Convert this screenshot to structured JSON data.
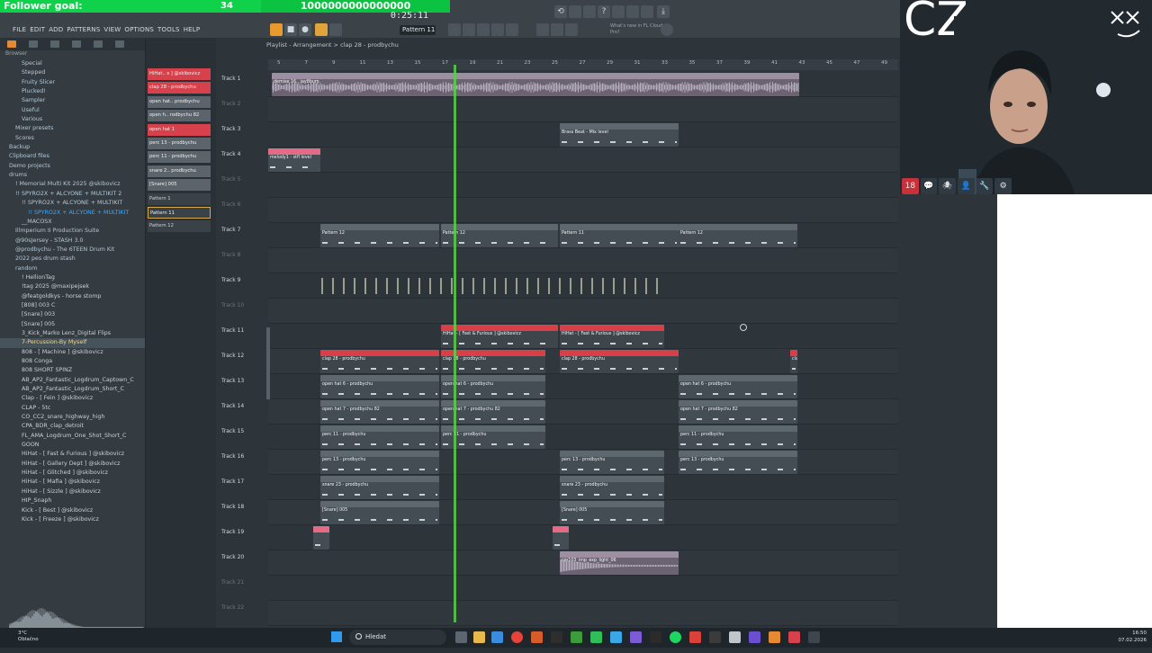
{
  "stream": {
    "follower_goal_label": "Follower goal:",
    "follower_count": "34",
    "follower_target": "1000000000000000",
    "channel_tag": "CZ"
  },
  "fl": {
    "menu": [
      "FILE",
      "EDIT",
      "ADD",
      "PATTERNS",
      "VIEW",
      "OPTIONS",
      "TOOLS",
      "HELP"
    ],
    "time_display": "0:25:11",
    "pattern_selector": "Pattern 11",
    "hint": "What's new in FL Cloud Pro?",
    "playlist_title": "Playlist - Arrangement > clap 28 - prodbychu",
    "ruler_ticks": [
      "5",
      "7",
      "9",
      "11",
      "13",
      "15",
      "17",
      "19",
      "21",
      "23",
      "25",
      "27",
      "29",
      "31",
      "33",
      "35",
      "37",
      "39",
      "41",
      "43",
      "45",
      "47",
      "49"
    ]
  },
  "browser": {
    "title": "Browser",
    "items": [
      {
        "label": "Special",
        "indent": 2,
        "kind": "folder"
      },
      {
        "label": "Stepped",
        "indent": 2,
        "kind": "folder"
      },
      {
        "label": "Fruity Slicer",
        "indent": 2,
        "kind": "folder"
      },
      {
        "label": "Plucked!",
        "indent": 2,
        "kind": "folder"
      },
      {
        "label": "Sampler",
        "indent": 2,
        "kind": "folder"
      },
      {
        "label": "Useful",
        "indent": 2,
        "kind": "folder"
      },
      {
        "label": "Various",
        "indent": 2,
        "kind": "folder"
      },
      {
        "label": "Mixer presets",
        "indent": 1,
        "kind": "folder"
      },
      {
        "label": "Scores",
        "indent": 1,
        "kind": "folder"
      },
      {
        "label": "Backup",
        "indent": 0,
        "kind": "folder"
      },
      {
        "label": "Clipboard files",
        "indent": 0,
        "kind": "folder"
      },
      {
        "label": "Demo projects",
        "indent": 0,
        "kind": "folder"
      },
      {
        "label": "drums",
        "indent": 0,
        "kind": "folder"
      },
      {
        "label": "! Memorial Multi Kit 2025 @skibovicz",
        "indent": 1,
        "kind": "folder"
      },
      {
        "label": "!! SPYRO2X + ALCYONE + MULTIKIT 2",
        "indent": 1,
        "kind": "folder"
      },
      {
        "label": "!! SPYRO2X + ALCYONE + MULTIKIT",
        "indent": 2,
        "kind": "folder"
      },
      {
        "label": "!! SPYRO2X + ALCYONE + MULTIKIT",
        "indent": 3,
        "kind": "hl"
      },
      {
        "label": "__MACOSX",
        "indent": 2,
        "kind": "folder"
      },
      {
        "label": "Illmperium II Production Suite",
        "indent": 1,
        "kind": "folder"
      },
      {
        "label": "@90sJersey - STASH 3.0",
        "indent": 1,
        "kind": "folder"
      },
      {
        "label": "@prodbychu - The 6TEEN Drum Kit",
        "indent": 1,
        "kind": "folder"
      },
      {
        "label": "2022 pes drum stash",
        "indent": 1,
        "kind": "folder"
      },
      {
        "label": "random",
        "indent": 1,
        "kind": "folder"
      },
      {
        "label": "! HellionTag",
        "indent": 2,
        "kind": "file"
      },
      {
        "label": "!tag 2025 @maxipejsek",
        "indent": 2,
        "kind": "file"
      },
      {
        "label": "@featgoldkys - horse stomp",
        "indent": 2,
        "kind": "file"
      },
      {
        "label": "[808] 003 C",
        "indent": 2,
        "kind": "file"
      },
      {
        "label": "[Snare] 003",
        "indent": 2,
        "kind": "file"
      },
      {
        "label": "[Snare] 005",
        "indent": 2,
        "kind": "file"
      },
      {
        "label": "3_Kick_Marko Lenz_Digital Flips",
        "indent": 2,
        "kind": "file"
      },
      {
        "label": "7-Percussion-By Myself",
        "indent": 2,
        "kind": "sel"
      },
      {
        "label": "808 - [ Machine ] @skibovicz",
        "indent": 2,
        "kind": "file"
      },
      {
        "label": "808 Conga",
        "indent": 2,
        "kind": "file"
      },
      {
        "label": "808 SHORT SPINZ",
        "indent": 2,
        "kind": "file"
      },
      {
        "label": "AB_AP2_Fantastic_Logdrum_Captown_C",
        "indent": 2,
        "kind": "file"
      },
      {
        "label": "AB_AP2_Fantastic_Logdrum_Short_C",
        "indent": 2,
        "kind": "file"
      },
      {
        "label": "Clap - [ Fein ] @skibovicz",
        "indent": 2,
        "kind": "file"
      },
      {
        "label": "CLAP - 5tc",
        "indent": 2,
        "kind": "file"
      },
      {
        "label": "CO_CC2_snare_highway_high",
        "indent": 2,
        "kind": "file"
      },
      {
        "label": "CPA_BDR_clap_detroit",
        "indent": 2,
        "kind": "file"
      },
      {
        "label": "FL_AMA_Logdrum_One_Shot_Short_C",
        "indent": 2,
        "kind": "file"
      },
      {
        "label": "GOON",
        "indent": 2,
        "kind": "file"
      },
      {
        "label": "HiHat - [ Fast & Furious ] @skibovicz",
        "indent": 2,
        "kind": "file"
      },
      {
        "label": "HiHat - [ Gallery Dept ] @skibovicz",
        "indent": 2,
        "kind": "file"
      },
      {
        "label": "HiHat - [ Glitched ] @skibovicz",
        "indent": 2,
        "kind": "file"
      },
      {
        "label": "HiHat - [ Mafia ] @skibovicz",
        "indent": 2,
        "kind": "file"
      },
      {
        "label": "HiHat - [ Sizzle ] @skibovicz",
        "indent": 2,
        "kind": "file"
      },
      {
        "label": "HIP_Snaph",
        "indent": 2,
        "kind": "file"
      },
      {
        "label": "Kick - [ Best ] @skibovicz",
        "indent": 2,
        "kind": "file"
      },
      {
        "label": "Kick - [ Freeze ] @skibovicz",
        "indent": 2,
        "kind": "file"
      }
    ]
  },
  "patterns": [
    {
      "label": "HiHat.. s ] @skibovicz",
      "style": "red"
    },
    {
      "label": "clap 28 - prodbychu",
      "style": "red"
    },
    {
      "label": "open hat.. prodbychu",
      "style": "grey"
    },
    {
      "label": "open h.. rodbychu 82",
      "style": "grey"
    },
    {
      "label": "open hat 1",
      "style": "red"
    },
    {
      "label": "perc 13 - prodbychu",
      "style": "grey"
    },
    {
      "label": "perc 11 - prodbychu",
      "style": "grey"
    },
    {
      "label": "snare 2.. prodbychu",
      "style": "grey"
    },
    {
      "label": "[Snare] 005",
      "style": "grey"
    },
    {
      "label": "Pattern 1",
      "style": "dim"
    },
    {
      "label": "Pattern 11",
      "style": "sel"
    },
    {
      "label": "Pattern 12",
      "style": "dim"
    }
  ],
  "tracks": [
    {
      "label": "Track 1",
      "clips": [
        {
          "title": "demise 16.. jay8bum",
          "kind": "audio-wave"
        }
      ]
    },
    {
      "label": "Track 2",
      "faint": true,
      "clips": []
    },
    {
      "label": "Track 3",
      "clips": [
        {
          "title": "Brass Beat - Mix level",
          "kind": "automation"
        }
      ]
    },
    {
      "label": "Track 4",
      "clips": [
        {
          "title": "melody1 - stfl level",
          "kind": "pink"
        }
      ]
    },
    {
      "label": "Track 5",
      "faint": true,
      "clips": []
    },
    {
      "label": "Track 6",
      "faint": true,
      "clips": []
    },
    {
      "label": "Track 7",
      "clips": [
        {
          "title": "Pattern 12"
        },
        {
          "title": "Pattern 12"
        },
        {
          "title": "Pattern 11"
        },
        {
          "title": "Pattern 12"
        }
      ]
    },
    {
      "label": "Track 8",
      "faint": true,
      "clips": []
    },
    {
      "label": "Track 9",
      "clips": [
        {
          "title": "",
          "kind": "hats"
        }
      ]
    },
    {
      "label": "Track 10",
      "faint": true,
      "clips": []
    },
    {
      "label": "Track 11",
      "clips": [
        {
          "title": "HiHat - [ Fast & Furious ] @skibovicz",
          "kind": "red"
        },
        {
          "title": "HiHat - [ Fast & Furious ] @skibovicz",
          "kind": "red"
        }
      ]
    },
    {
      "label": "Track 12",
      "clips": [
        {
          "title": "clap 28 - prodbychu",
          "kind": "red"
        },
        {
          "title": "clap 28 - prodbychu",
          "kind": "red"
        },
        {
          "title": "clap 28 - prodbychu",
          "kind": "red"
        },
        {
          "title": "clap 28 - prodbychu",
          "kind": "red"
        }
      ]
    },
    {
      "label": "Track 13",
      "clips": [
        {
          "title": "open hat 6 - prodbychu"
        },
        {
          "title": "open hat 6 - prodbychu"
        },
        {
          "title": "open hat 6 - prodbychu"
        }
      ]
    },
    {
      "label": "Track 14",
      "clips": [
        {
          "title": "open hat 7 - prodbychu 82"
        },
        {
          "title": "open hat 7 - prodbychu 82"
        },
        {
          "title": "open hat 7 - prodbychu 82"
        }
      ]
    },
    {
      "label": "Track 15",
      "clips": [
        {
          "title": "perc 11 - prodbychu"
        },
        {
          "title": "perc 11 - prodbychu"
        },
        {
          "title": "perc 11 - prodbychu"
        }
      ]
    },
    {
      "label": "Track 16",
      "clips": [
        {
          "title": "perc 13 - prodbychu"
        },
        {
          "title": "perc 13 - prodbychu"
        },
        {
          "title": "perc 13 - prodbychu"
        }
      ]
    },
    {
      "label": "Track 17",
      "clips": [
        {
          "title": "snare 23 - prodbychu"
        },
        {
          "title": "snare 23 - prodbychu"
        }
      ]
    },
    {
      "label": "Track 18",
      "clips": [
        {
          "title": "[Snare] 005"
        },
        {
          "title": "[Snare] 005"
        }
      ]
    },
    {
      "label": "Track 19",
      "clips": [
        {
          "title": "",
          "kind": "pink"
        },
        {
          "title": "",
          "kind": "pink"
        }
      ]
    },
    {
      "label": "Track 20",
      "clips": [
        {
          "title": "cm103_imp_exp_light_06",
          "kind": "audio"
        }
      ]
    },
    {
      "label": "Track 21",
      "faint": true,
      "clips": []
    },
    {
      "label": "Track 22",
      "faint": true,
      "clips": []
    }
  ],
  "taskbar": {
    "weather_temp": "3°C",
    "weather_desc": "Oblačno",
    "search_placeholder": "Hledat",
    "time": "16:50",
    "date": "07.02.2026"
  },
  "badges": [
    "18",
    "💬",
    "🕷",
    "👤",
    "🔧",
    "⚙"
  ]
}
